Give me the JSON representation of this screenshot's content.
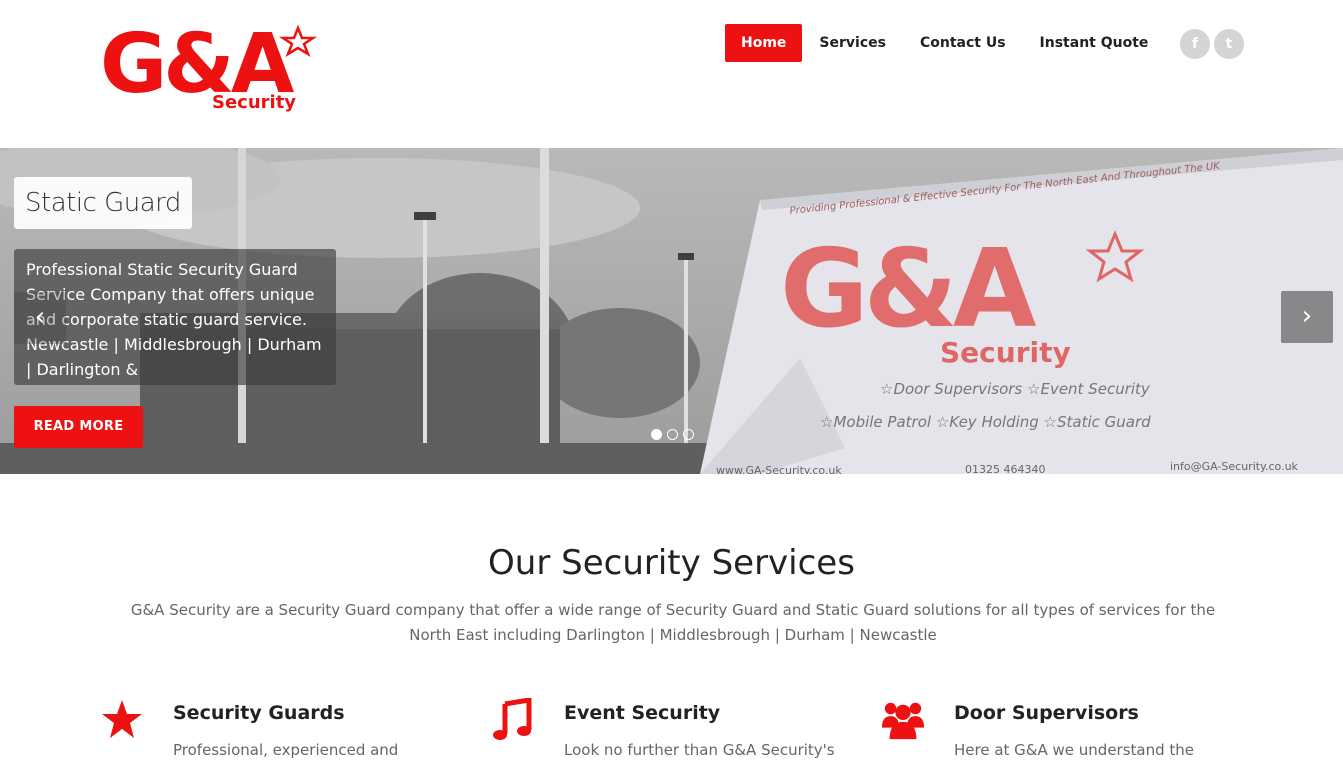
{
  "colors": {
    "accent": "#ee1111",
    "social": "#d4d4d4"
  },
  "logo": {
    "main_text": "G&A",
    "sub_text": "Security"
  },
  "nav": {
    "items": [
      "Home",
      "Services",
      "Contact Us",
      "Instant Quote"
    ],
    "active": "Home"
  },
  "social": {
    "facebook_icon": "f",
    "twitter_icon": "t"
  },
  "hero": {
    "title": "Static Guard",
    "description": "Professional Static Security Guard Service Company that offers unique and corporate static guard service. Newcastle | Middlesbrough | Durham | Darlington &",
    "button": "READ MORE",
    "prev_icon": "‹",
    "next_icon": "›",
    "banner": {
      "tagline": "Providing Professional & Effective Security For The North East And Throughout The UK",
      "logo_main": "G&A",
      "logo_sub": "Security",
      "services_row1": "☆Door Supervisors ☆Event Security",
      "services_row2": "☆Mobile Patrol ☆Key Holding ☆Static Guard",
      "website": "www.GA-Security.co.uk",
      "phone": "01325 464340",
      "email": "info@GA-Security.co.uk"
    }
  },
  "services_section": {
    "title": "Our Security Services",
    "intro": "G&A Security are a Security Guard company that offer a wide range of Security Guard and Static Guard solutions for all types of services for the North East including Darlington | Middlesbrough | Durham | Newcastle",
    "items": [
      {
        "icon": "star-icon",
        "title": "Security Guards",
        "text": "Professional, experienced and"
      },
      {
        "icon": "music-icon",
        "title": "Event Security",
        "text": "Look no further than G&A Security's"
      },
      {
        "icon": "users-icon",
        "title": "Door Supervisors",
        "text": "Here at G&A we understand the"
      }
    ]
  }
}
